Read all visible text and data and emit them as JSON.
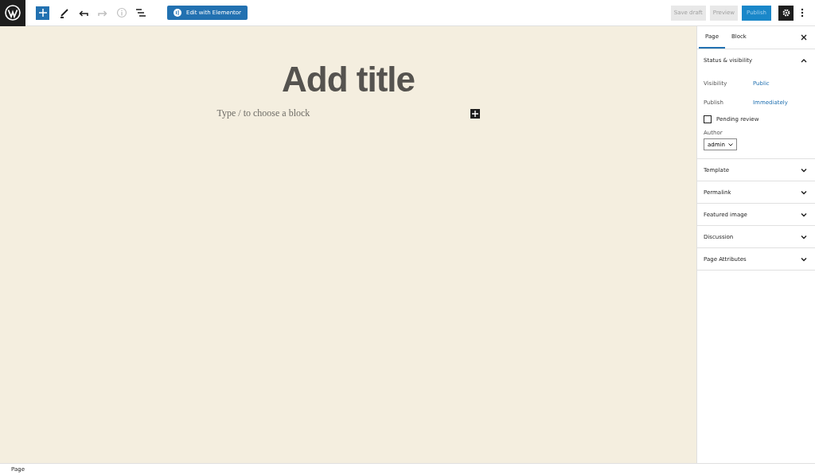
{
  "toolbar": {
    "tools": [
      {
        "kind": "add",
        "disabled": false
      },
      {
        "kind": "edit",
        "disabled": false
      },
      {
        "kind": "undo",
        "disabled": false
      },
      {
        "kind": "redo",
        "disabled": true
      },
      {
        "kind": "info",
        "disabled": true
      },
      {
        "kind": "outline",
        "disabled": false
      }
    ],
    "elementor_button": "Edit with Elementor",
    "save_draft": "Save draft",
    "preview": "Preview",
    "publish": "Publish",
    "settings_on": true
  },
  "editor": {
    "title_placeholder": "Add title",
    "block_placeholder": "Type / to choose a block"
  },
  "sidebar": {
    "tabs": [
      {
        "label": "Page",
        "selected": true
      },
      {
        "label": "Block",
        "selected": false
      }
    ],
    "panels": [
      {
        "title": "Status & visibility",
        "expanded": true
      },
      {
        "title": "Template",
        "expanded": false
      },
      {
        "title": "Permalink",
        "expanded": false
      },
      {
        "title": "Featured image",
        "expanded": false
      },
      {
        "title": "Discussion",
        "expanded": false
      },
      {
        "title": "Page Attributes",
        "expanded": false
      }
    ],
    "status": {
      "rows": [
        {
          "label": "Visibility",
          "value": "Public"
        },
        {
          "label": "Publish",
          "value": "Immediately"
        }
      ],
      "pending_review": {
        "label": "Pending review",
        "checked": false
      },
      "author": {
        "label": "Author",
        "value": "admin"
      }
    }
  },
  "status_bar": "Page"
}
